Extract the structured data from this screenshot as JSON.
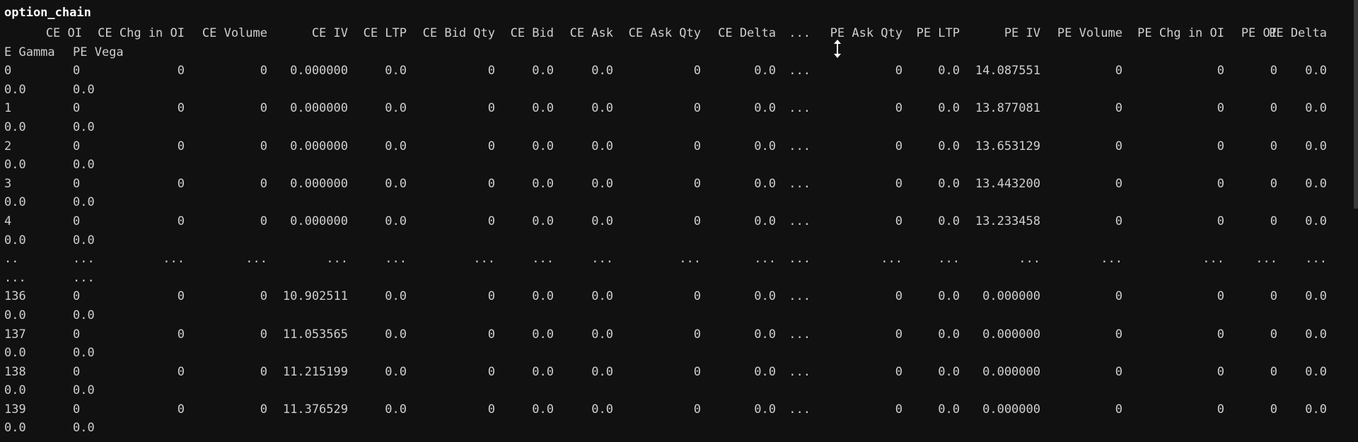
{
  "cell": {
    "input_text": "option_chain"
  },
  "table": {
    "header": [
      "CE OI",
      "CE Chg in OI",
      "CE Volume",
      "CE IV",
      "CE LTP",
      "CE Bid Qty",
      "CE Bid",
      "CE Ask",
      "CE Ask Qty",
      "CE Delta",
      "...",
      "PE Ask Qty",
      "PE LTP",
      "PE IV",
      "PE Volume",
      "PE Chg in OI",
      "PE OI",
      "PE Delta"
    ],
    "header_wrap": [
      "E Gamma",
      "PE Vega"
    ],
    "rows": [
      {
        "index": "0",
        "cells": [
          "0",
          "0",
          "0",
          "0.000000",
          "0.0",
          "0",
          "0.0",
          "0.0",
          "0",
          "0.0",
          "...",
          "0",
          "0.0",
          "14.087551",
          "0",
          "0",
          "0",
          "0.0"
        ],
        "wrap": [
          "0.0",
          "0.0"
        ]
      },
      {
        "index": "1",
        "cells": [
          "0",
          "0",
          "0",
          "0.000000",
          "0.0",
          "0",
          "0.0",
          "0.0",
          "0",
          "0.0",
          "...",
          "0",
          "0.0",
          "13.877081",
          "0",
          "0",
          "0",
          "0.0"
        ],
        "wrap": [
          "0.0",
          "0.0"
        ]
      },
      {
        "index": "2",
        "cells": [
          "0",
          "0",
          "0",
          "0.000000",
          "0.0",
          "0",
          "0.0",
          "0.0",
          "0",
          "0.0",
          "...",
          "0",
          "0.0",
          "13.653129",
          "0",
          "0",
          "0",
          "0.0"
        ],
        "wrap": [
          "0.0",
          "0.0"
        ]
      },
      {
        "index": "3",
        "cells": [
          "0",
          "0",
          "0",
          "0.000000",
          "0.0",
          "0",
          "0.0",
          "0.0",
          "0",
          "0.0",
          "...",
          "0",
          "0.0",
          "13.443200",
          "0",
          "0",
          "0",
          "0.0"
        ],
        "wrap": [
          "0.0",
          "0.0"
        ]
      },
      {
        "index": "4",
        "cells": [
          "0",
          "0",
          "0",
          "0.000000",
          "0.0",
          "0",
          "0.0",
          "0.0",
          "0",
          "0.0",
          "...",
          "0",
          "0.0",
          "13.233458",
          "0",
          "0",
          "0",
          "0.0"
        ],
        "wrap": [
          "0.0",
          "0.0"
        ]
      },
      {
        "index": "..",
        "cells": [
          "...",
          "...",
          "...",
          "...",
          "...",
          "...",
          "...",
          "...",
          "...",
          "...",
          "...",
          "...",
          "...",
          "...",
          "...",
          "...",
          "...",
          "..."
        ],
        "wrap": [
          "...",
          "..."
        ]
      },
      {
        "index": "136",
        "cells": [
          "0",
          "0",
          "0",
          "10.902511",
          "0.0",
          "0",
          "0.0",
          "0.0",
          "0",
          "0.0",
          "...",
          "0",
          "0.0",
          "0.000000",
          "0",
          "0",
          "0",
          "0.0"
        ],
        "wrap": [
          "0.0",
          "0.0"
        ]
      },
      {
        "index": "137",
        "cells": [
          "0",
          "0",
          "0",
          "11.053565",
          "0.0",
          "0",
          "0.0",
          "0.0",
          "0",
          "0.0",
          "...",
          "0",
          "0.0",
          "0.000000",
          "0",
          "0",
          "0",
          "0.0"
        ],
        "wrap": [
          "0.0",
          "0.0"
        ]
      },
      {
        "index": "138",
        "cells": [
          "0",
          "0",
          "0",
          "11.215199",
          "0.0",
          "0",
          "0.0",
          "0.0",
          "0",
          "0.0",
          "...",
          "0",
          "0.0",
          "0.000000",
          "0",
          "0",
          "0",
          "0.0"
        ],
        "wrap": [
          "0.0",
          "0.0"
        ]
      },
      {
        "index": "139",
        "cells": [
          "0",
          "0",
          "0",
          "11.376529",
          "0.0",
          "0",
          "0.0",
          "0.0",
          "0",
          "0.0",
          "...",
          "0",
          "0.0",
          "0.000000",
          "0",
          "0",
          "0",
          "0.0"
        ],
        "wrap": [
          "0.0",
          "0.0"
        ]
      }
    ]
  },
  "cursor_icon": "vertical-resize-icon"
}
